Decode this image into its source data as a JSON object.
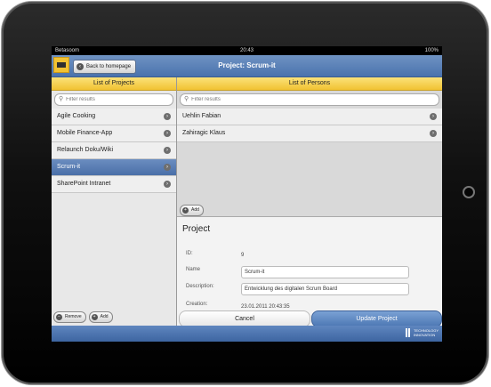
{
  "statusbar": {
    "carrier": "Betasoom",
    "clock": "20:43",
    "battery": "100%"
  },
  "navbar": {
    "title": "Project: Scrum-it",
    "back_label": "Back to homepage"
  },
  "projects_panel": {
    "header": "List of Projects",
    "search_placeholder": "Filter results",
    "items": [
      {
        "label": "Agile Cooking"
      },
      {
        "label": "Mobile Finance-App"
      },
      {
        "label": "Relaunch Doku/Wiki"
      },
      {
        "label": "Scrum-it"
      },
      {
        "label": "SharePoint Intranet"
      }
    ],
    "remove_label": "Remove",
    "add_label": "Add"
  },
  "persons_panel": {
    "header": "List of Persons",
    "search_placeholder": "Filter results",
    "items": [
      {
        "label": "Uehlin Fabian"
      },
      {
        "label": "Zahiragic Klaus"
      }
    ],
    "add_label": "Add"
  },
  "project_detail": {
    "title": "Project",
    "id_label": "ID:",
    "id_value": "9",
    "name_label": "Name",
    "name_value": "Scrum-it",
    "description_label": "Description:",
    "description_value": "Entwicklung des digitalen Scrum Board",
    "creation_label": "Creation:",
    "creation_value": "23.01.2011 20:43:35",
    "cancel_label": "Cancel",
    "update_label": "Update Project"
  },
  "footer": {
    "brand_line1": "TECHNOLOGY",
    "brand_line2": "INNOVATION"
  },
  "colors": {
    "nav_blue": "#4a72ad",
    "header_yellow": "#f1c232",
    "selected_row": "#4a6fa8"
  }
}
